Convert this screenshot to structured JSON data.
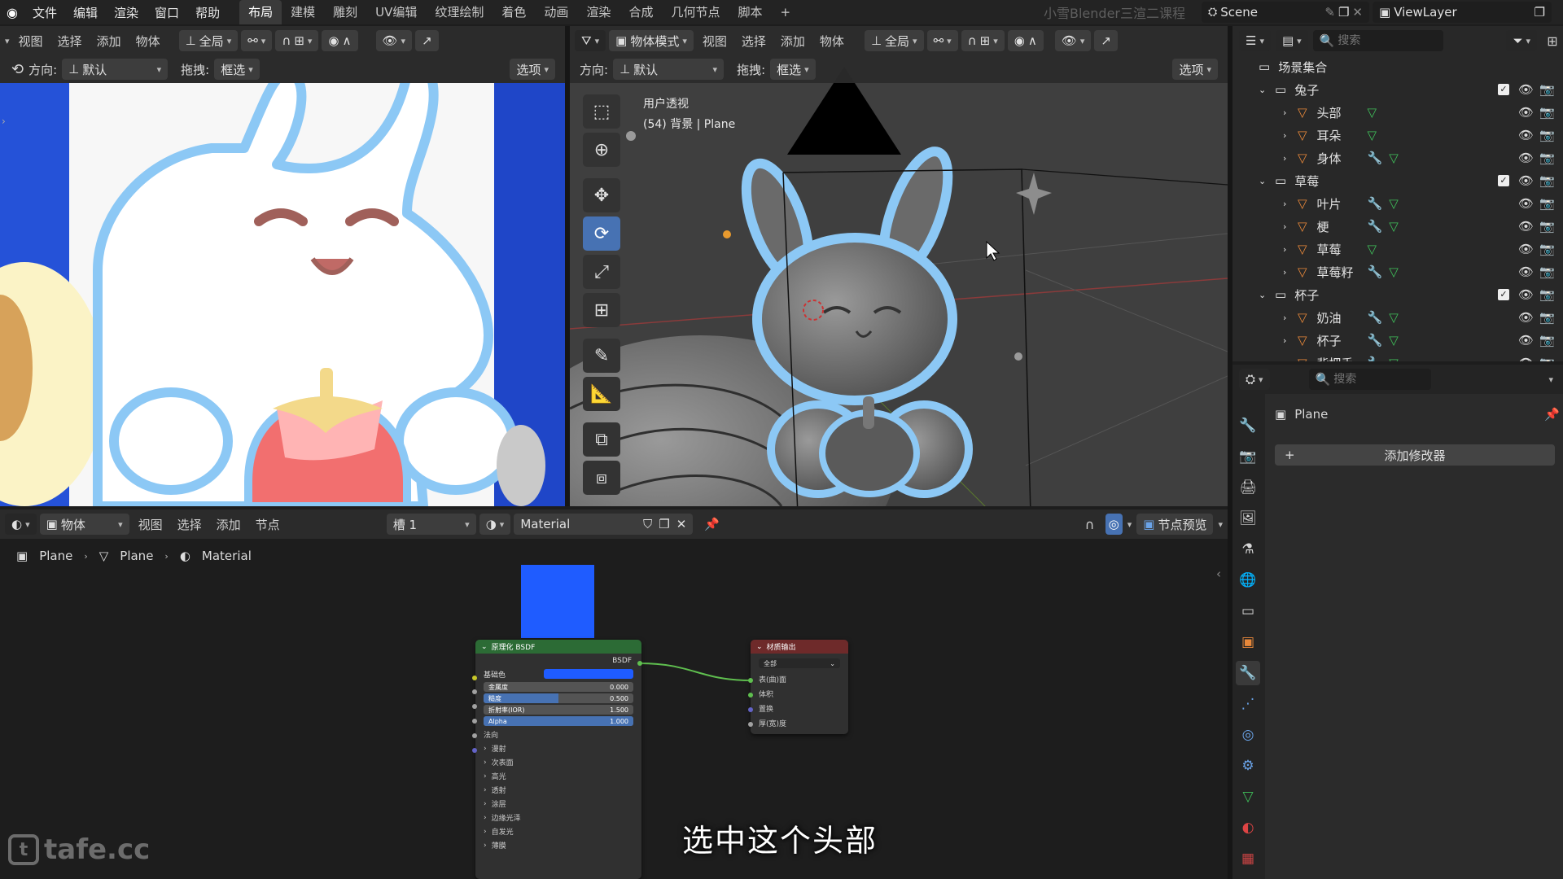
{
  "topbar": {
    "menus": [
      "文件",
      "编辑",
      "渲染",
      "窗口",
      "帮助"
    ],
    "workspaces": [
      "布局",
      "建模",
      "雕刻",
      "UV编辑",
      "纹理绘制",
      "着色",
      "动画",
      "渲染",
      "合成",
      "几何节点",
      "脚本"
    ],
    "active_workspace": "布局",
    "add_tab": "+",
    "watermark": "小雪Blender三渲二课程",
    "scene": "Scene",
    "view_layer": "ViewLayer"
  },
  "left_view": {
    "menus": [
      "视图",
      "选择",
      "添加",
      "物体"
    ],
    "transform": "全局",
    "orientation_label": "方向:",
    "orientation_value": "默认",
    "drag_label": "拖拽:",
    "drag_value": "框选",
    "options": "选项"
  },
  "viewport": {
    "mode": "物体模式",
    "menus": [
      "视图",
      "选择",
      "添加",
      "物体"
    ],
    "transform": "全局",
    "orientation_label": "方向:",
    "orientation_value": "默认",
    "drag_label": "拖拽:",
    "drag_value": "框选",
    "options": "选项",
    "overlay_title": "用户透视",
    "overlay_sub": "(54) 背景 | Plane"
  },
  "outliner": {
    "search_placeholder": "搜索",
    "root": "场景集合",
    "collections": [
      {
        "name": "兔子",
        "children": [
          "头部",
          "耳朵",
          "身体"
        ]
      },
      {
        "name": "草莓",
        "children": [
          "叶片",
          "梗",
          "草莓",
          "草莓籽"
        ]
      },
      {
        "name": "杯子",
        "children": [
          "奶油",
          "杯子",
          "背把手"
        ]
      }
    ]
  },
  "properties": {
    "search_placeholder": "搜索",
    "object": "Plane",
    "add_modifier": "添加修改器"
  },
  "node_editor": {
    "editor_type": "物体",
    "menus": [
      "视图",
      "选择",
      "添加",
      "节点"
    ],
    "slot": "槽 1",
    "material": "Material",
    "preview_label": "节点预览",
    "breadcrumb": [
      "Plane",
      "Plane",
      "Material"
    ],
    "bsdf": {
      "title": "原理化 BSDF",
      "output": "BSDF",
      "base_color_label": "基础色",
      "fields": [
        {
          "label": "金属度",
          "value": "0.000",
          "fill": 0
        },
        {
          "label": "糙度",
          "value": "0.500",
          "fill": 0.5
        },
        {
          "label": "折射率(IOR)",
          "value": "1.500",
          "fill": 0
        },
        {
          "label": "Alpha",
          "value": "1.000",
          "fill": 1
        }
      ],
      "normal": "法向",
      "subpanels": [
        "漫射",
        "次表面",
        "高光",
        "透射",
        "涂层",
        "边缘光泽",
        "自发光",
        "薄膜"
      ]
    },
    "output_node": {
      "title": "材质输出",
      "target": "全部",
      "inputs": [
        "表(曲)面",
        "体积",
        "置换",
        "厚(宽)度"
      ]
    }
  },
  "subtitle": "选中这个头部",
  "logo_text": "tafe.cc",
  "colors": {
    "accent": "#4772b3",
    "bsdf_header": "#2c6b35",
    "output_header": "#6e2a2a",
    "base_color": "#1f5cff",
    "outline": "#8cc8f5"
  }
}
